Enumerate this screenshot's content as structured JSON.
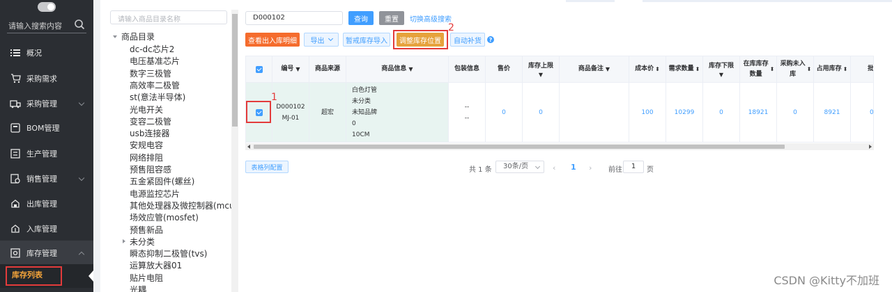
{
  "sidebar": {
    "search_placeholder": "请输入搜索内容",
    "items": [
      {
        "label": "概况",
        "icon": "list-icon"
      },
      {
        "label": "采购需求",
        "icon": "cart-icon"
      },
      {
        "label": "采购管理",
        "icon": "purchase-icon"
      },
      {
        "label": "BOM管理",
        "icon": "bom-icon"
      },
      {
        "label": "生产管理",
        "icon": "production-icon"
      },
      {
        "label": "销售管理",
        "icon": "sales-icon"
      },
      {
        "label": "出库管理",
        "icon": "outbound-icon"
      },
      {
        "label": "入库管理",
        "icon": "inbound-icon"
      },
      {
        "label": "库存管理",
        "icon": "inventory-icon"
      }
    ],
    "active_sub": "库存列表"
  },
  "tree": {
    "search_placeholder": "请输入商品目录名称",
    "root": "商品目录",
    "nodes": [
      "dc-dc芯片2",
      "电压基准芯片",
      "数字三极管",
      "高效率二极管",
      "st(意法半导体)",
      "光电开关",
      "变容二极管",
      "usb连接器",
      "安规电容",
      "网络排阻",
      "预售阻容感",
      "五金紧固件(螺丝)",
      "电源监控芯片",
      "其他处理器及微控制器(mcu)",
      "场效应管(mosfet)",
      "预售新品",
      "未分类",
      "瞬态抑制二极管(tvs)",
      "运算放大器01",
      "贴片电阻",
      "光耦"
    ]
  },
  "toolbar": {
    "code_value": "D000102",
    "query": "查询",
    "reset": "重置",
    "advanced": "切换高级搜索",
    "view_io": "查看出入库明细",
    "export": "导出",
    "sec_import": "暂戒库存导入",
    "adjust": "调整库存位置",
    "auto_fill": "自动补货"
  },
  "annotations": {
    "one": "1",
    "two": "2"
  },
  "table": {
    "headers": [
      "编号",
      "商品来源",
      "商品信息",
      "包装信息",
      "售价",
      "库存上限",
      "商品备注",
      "成本价",
      "需求数量",
      "库存下限",
      "在库库存数量",
      "采购未入库",
      "占用库存",
      "批次"
    ],
    "row": {
      "code_line1": "D000102",
      "code_line2": "MJ-01",
      "source": "超宏",
      "info": [
        "白色灯管",
        "未分类",
        "未知品牌",
        "0",
        "10CM"
      ],
      "pack_line1": "--",
      "pack_line2": "--",
      "price": "0",
      "upper": "0",
      "cost": "100",
      "demand": "10299",
      "lower": "0",
      "in_stock": "18921",
      "not_in": "0",
      "occupied": "8921",
      "batch": "0"
    }
  },
  "footer": {
    "config": "表格列配置",
    "total": "共 1 条",
    "page_size": "30条/页",
    "prev": "‹",
    "current": "1",
    "next": "›",
    "goto": "前往",
    "goto_value": "1",
    "page": "页"
  },
  "watermark": "CSDN @Kitty不加班",
  "colors": {
    "sidebar": "#2b2e33",
    "primary": "#409eff",
    "highlight": "#e33b3b",
    "accent": "#e6a23c"
  }
}
